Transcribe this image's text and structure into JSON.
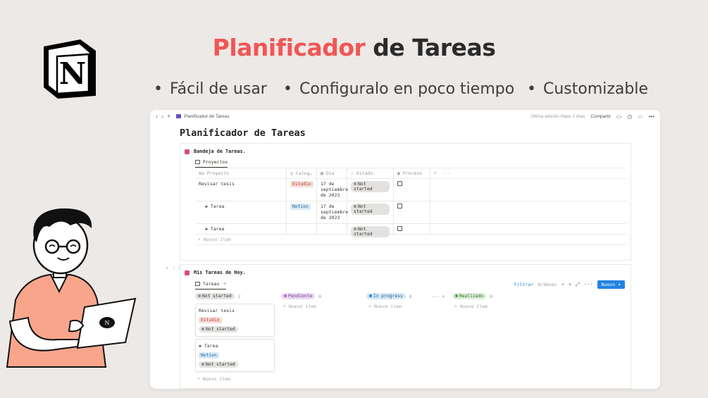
{
  "hero": {
    "title_highlight": "Planificador",
    "title_rest": " de Tareas",
    "features": [
      "Fácil de usar",
      "Configuralo en poco tiempo",
      "Customizable"
    ]
  },
  "logo": {
    "icon": "notion-logo",
    "letter": "N"
  },
  "topbar": {
    "breadcrumb": "Planificador de Tareas",
    "last_edit": "Última edición Hace 1 días",
    "share": "Compartir"
  },
  "page": {
    "title": "Planificador de Tareas"
  },
  "inbox": {
    "title": "Bandeja de Tareas.",
    "tab": "Proyectos",
    "columns": [
      "Proyecto",
      "Categ…",
      "Día",
      "Estado",
      "Proceso"
    ],
    "rows": [
      {
        "name": "Revisar tesis",
        "category": "Estudio",
        "date": "17 de septiembre de 2023",
        "status": "Not started"
      },
      {
        "name": "Tarea",
        "category": "Notion",
        "date": "17 de septiembre de 2023",
        "status": "Not started"
      },
      {
        "name": "Tarea",
        "category": "",
        "date": "",
        "status": "Not started"
      }
    ],
    "new_item": "+ Nuevo ítem"
  },
  "today": {
    "title": "Mis Tareas de Hoy.",
    "tab": "Tareas",
    "filter": "Filtrar",
    "sort": "Ordenar",
    "new_button": "Nuevo",
    "groups": [
      {
        "label": "Not started",
        "count": "2"
      },
      {
        "label": "Pendiente",
        "count": "0"
      },
      {
        "label": "In progress",
        "count": "0"
      },
      {
        "label": "Realizado",
        "count": "0"
      }
    ],
    "cards": [
      {
        "title": "Revisar tesis",
        "category": "Estudio",
        "status": "Not started"
      },
      {
        "title": "Tarea",
        "category": "Notion",
        "status": "Not started"
      }
    ],
    "new_item": "+ Nuevo ítem"
  },
  "colors": {
    "accent": "#f05656",
    "primary_button": "#2383e2",
    "background": "#ece9e6"
  }
}
